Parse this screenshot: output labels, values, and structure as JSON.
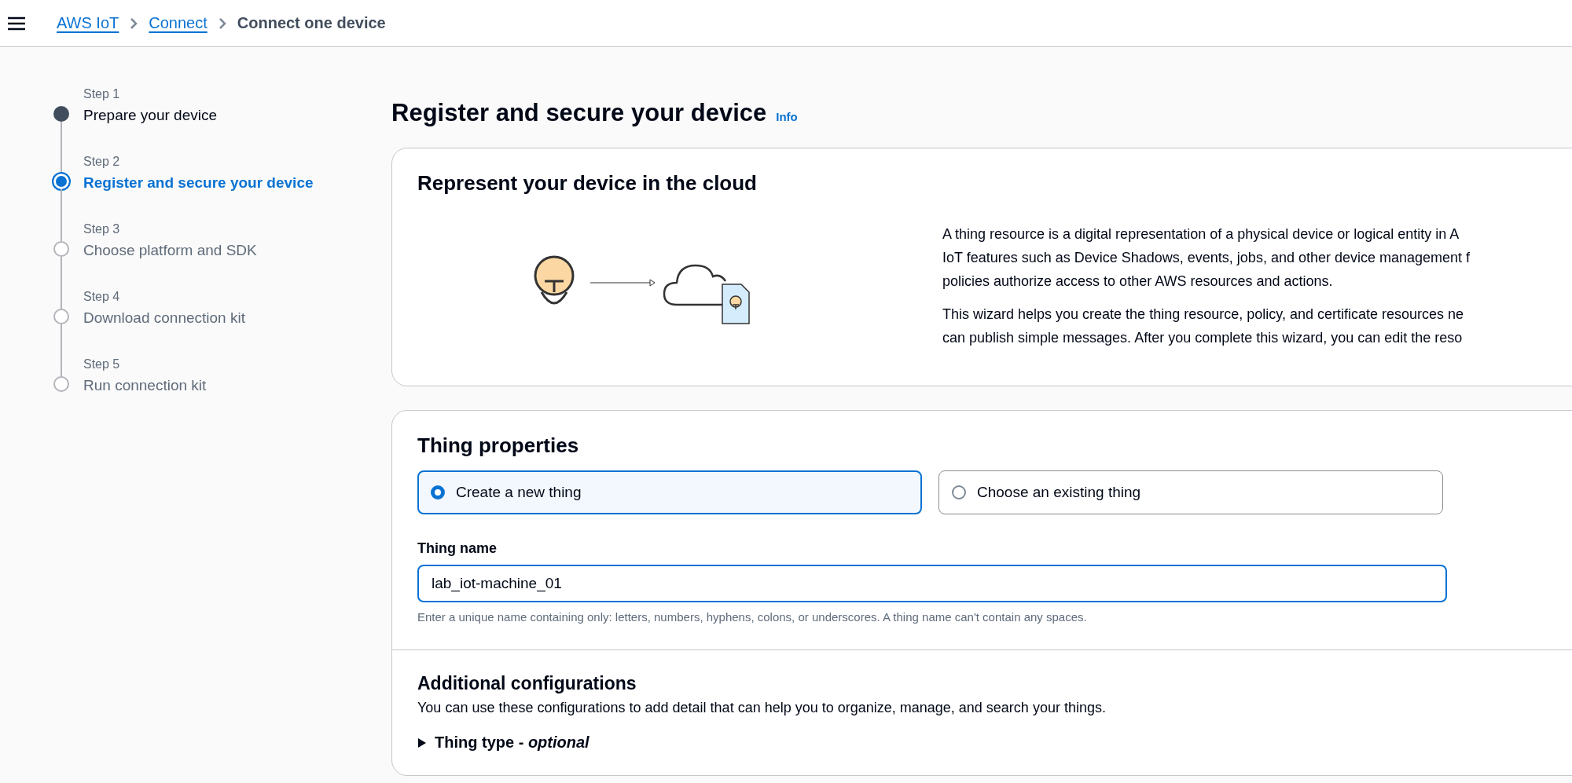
{
  "breadcrumbs": [
    {
      "label": "AWS IoT",
      "kind": "link"
    },
    {
      "label": "Connect",
      "kind": "link"
    },
    {
      "label": "Connect one device",
      "kind": "current"
    }
  ],
  "steps": [
    {
      "step": "Step 1",
      "title": "Prepare your device",
      "completed": true,
      "selected": false
    },
    {
      "step": "Step 2",
      "title": "Register and secure your device",
      "completed": false,
      "selected": true
    },
    {
      "step": "Step 3",
      "title": "Choose platform and SDK",
      "completed": false,
      "selected": false
    },
    {
      "step": "Step 4",
      "title": "Download connection kit",
      "completed": false,
      "selected": false
    },
    {
      "step": "Step 5",
      "title": "Run connection kit",
      "completed": false,
      "selected": false
    }
  ],
  "page": {
    "title": "Register and secure your device",
    "info": "Info"
  },
  "cloud_card": {
    "title": "Represent your device in the cloud",
    "paragraphs": [
      [
        "A thing resource is a digital representation of a physical device or logical entity in A",
        "IoT features such as Device Shadows, events, jobs, and other device management f",
        "policies authorize access to other AWS resources and actions."
      ],
      [
        "This wizard helps you create the thing resource, policy, and certificate resources ne",
        "can publish simple messages. After you complete this wizard, you can edit the reso"
      ]
    ]
  },
  "thing_properties": {
    "title": "Thing properties",
    "options": [
      {
        "label": "Create a new thing",
        "selected": true
      },
      {
        "label": "Choose an existing thing",
        "selected": false
      }
    ],
    "thing_name": {
      "label": "Thing name",
      "value": "lab_iot-machine_01",
      "focused": true,
      "hint": "Enter a unique name containing only: letters, numbers, hyphens, colons, or underscores. A thing name can't contain any spaces."
    }
  },
  "additional": {
    "title": "Additional configurations",
    "description": "You can use these configurations to add detail that can help you to organize, manage, and search your things.",
    "sections": [
      {
        "label": "Thing type - *optional*",
        "expanded": false
      }
    ]
  }
}
